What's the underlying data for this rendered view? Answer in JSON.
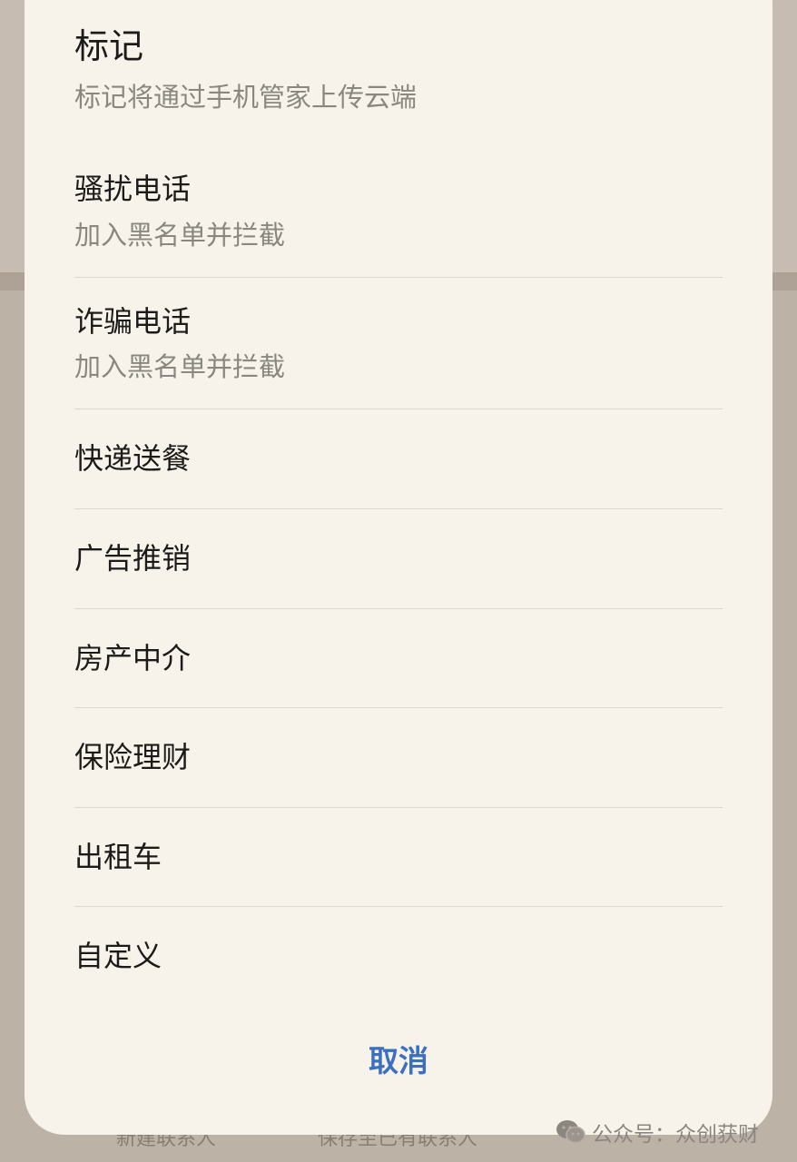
{
  "dialog": {
    "title": "标记",
    "subtitle": "标记将通过手机管家上传云端",
    "options": [
      {
        "label": "骚扰电话",
        "sub": "加入黑名单并拦截"
      },
      {
        "label": "诈骗电话",
        "sub": "加入黑名单并拦截"
      },
      {
        "label": "快递送餐"
      },
      {
        "label": "广告推销"
      },
      {
        "label": "房产中介"
      },
      {
        "label": "保险理财"
      },
      {
        "label": "出租车"
      },
      {
        "label": "自定义"
      }
    ],
    "cancel_label": "取消"
  },
  "background": {
    "bottom_left_text": "新建联系人",
    "bottom_mid_text": "保存至已有联系人"
  },
  "watermark": {
    "icon": "wechat-icon",
    "text": "公众号：众创获财"
  },
  "colors": {
    "accent": "#3a6fc4",
    "sheet_background": "#f7f3ea",
    "overlay": "#b8ada1"
  }
}
